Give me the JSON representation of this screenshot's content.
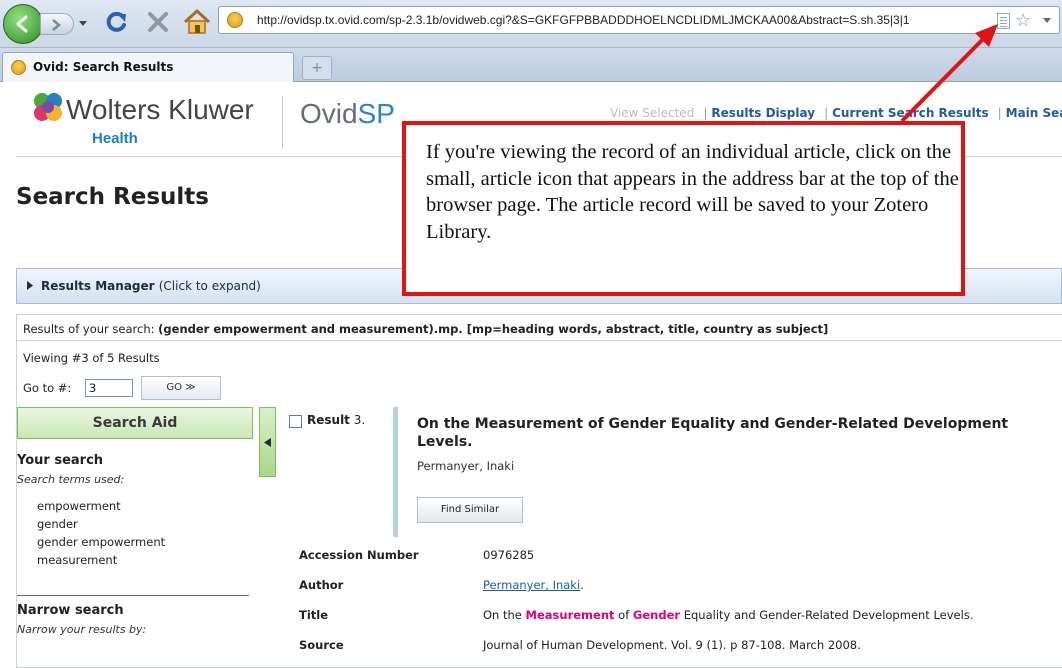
{
  "browser": {
    "url": "http://ovidsp.tx.ovid.com/sp-2.3.1b/ovidweb.cgi?&S=GKFGFPBBADDDHOELNCDLIDMLJMCKAA00&Abstract=S.sh.35|3|1",
    "tab_title": "Ovid: Search Results",
    "new_tab_glyph": "+"
  },
  "header": {
    "brand_name": "Wolters Kluwer",
    "brand_sub": "Health",
    "product_name_a": "Ovid",
    "product_name_b": "SP",
    "links": {
      "view_selected": "View Selected",
      "results_display": "Results Display",
      "current_search_results": "Current Search Results",
      "main_search": "Main Search P"
    },
    "separator": "|"
  },
  "page": {
    "title": "Search Results",
    "results_manager_label": "Results Manager",
    "results_manager_hint": "(Click to expand)",
    "query_prefix": "Results of your search:",
    "query_text": "(gender empowerment and measurement).mp. [mp=heading words, abstract, title, country as subject]",
    "viewing_text": "Viewing #3 of 5 Results",
    "goto_label": "Go to #:",
    "goto_value": "3",
    "go_button": "GO ≫"
  },
  "search_aid": {
    "title": "Search Aid",
    "your_search": "Your search",
    "terms_label": "Search terms used:",
    "terms": [
      "empowerment",
      "gender",
      "gender empowerment",
      "measurement"
    ],
    "narrow_search": "Narrow search",
    "narrow_label": "Narrow your results by:"
  },
  "result": {
    "label": "Result",
    "number": "3.",
    "title": "On the Measurement of Gender Equality and Gender-Related Development Levels.",
    "author": "Permanyer, Inaki",
    "find_similar": "Find Similar",
    "fields": {
      "accession_label": "Accession Number",
      "accession_value": "0976285",
      "author_label": "Author",
      "author_value": "Permanyer, Inaki",
      "author_suffix": ".",
      "title_label": "Title",
      "title_pre": "On the",
      "title_hl1": "Measurement",
      "title_mid": "of",
      "title_hl2": "Gender",
      "title_post": "Equality and Gender-Related Development Levels.",
      "source_label": "Source",
      "source_value": "Journal of Human Development. Vol. 9 (1). p 87-108. March 2008."
    }
  },
  "annotation": {
    "text": "If you're viewing the record of an individual article, click on the small, article icon that appears in the address bar at the top of the browser page.  The article record will be saved to your Zotero Library.",
    "color": "#e11414"
  }
}
